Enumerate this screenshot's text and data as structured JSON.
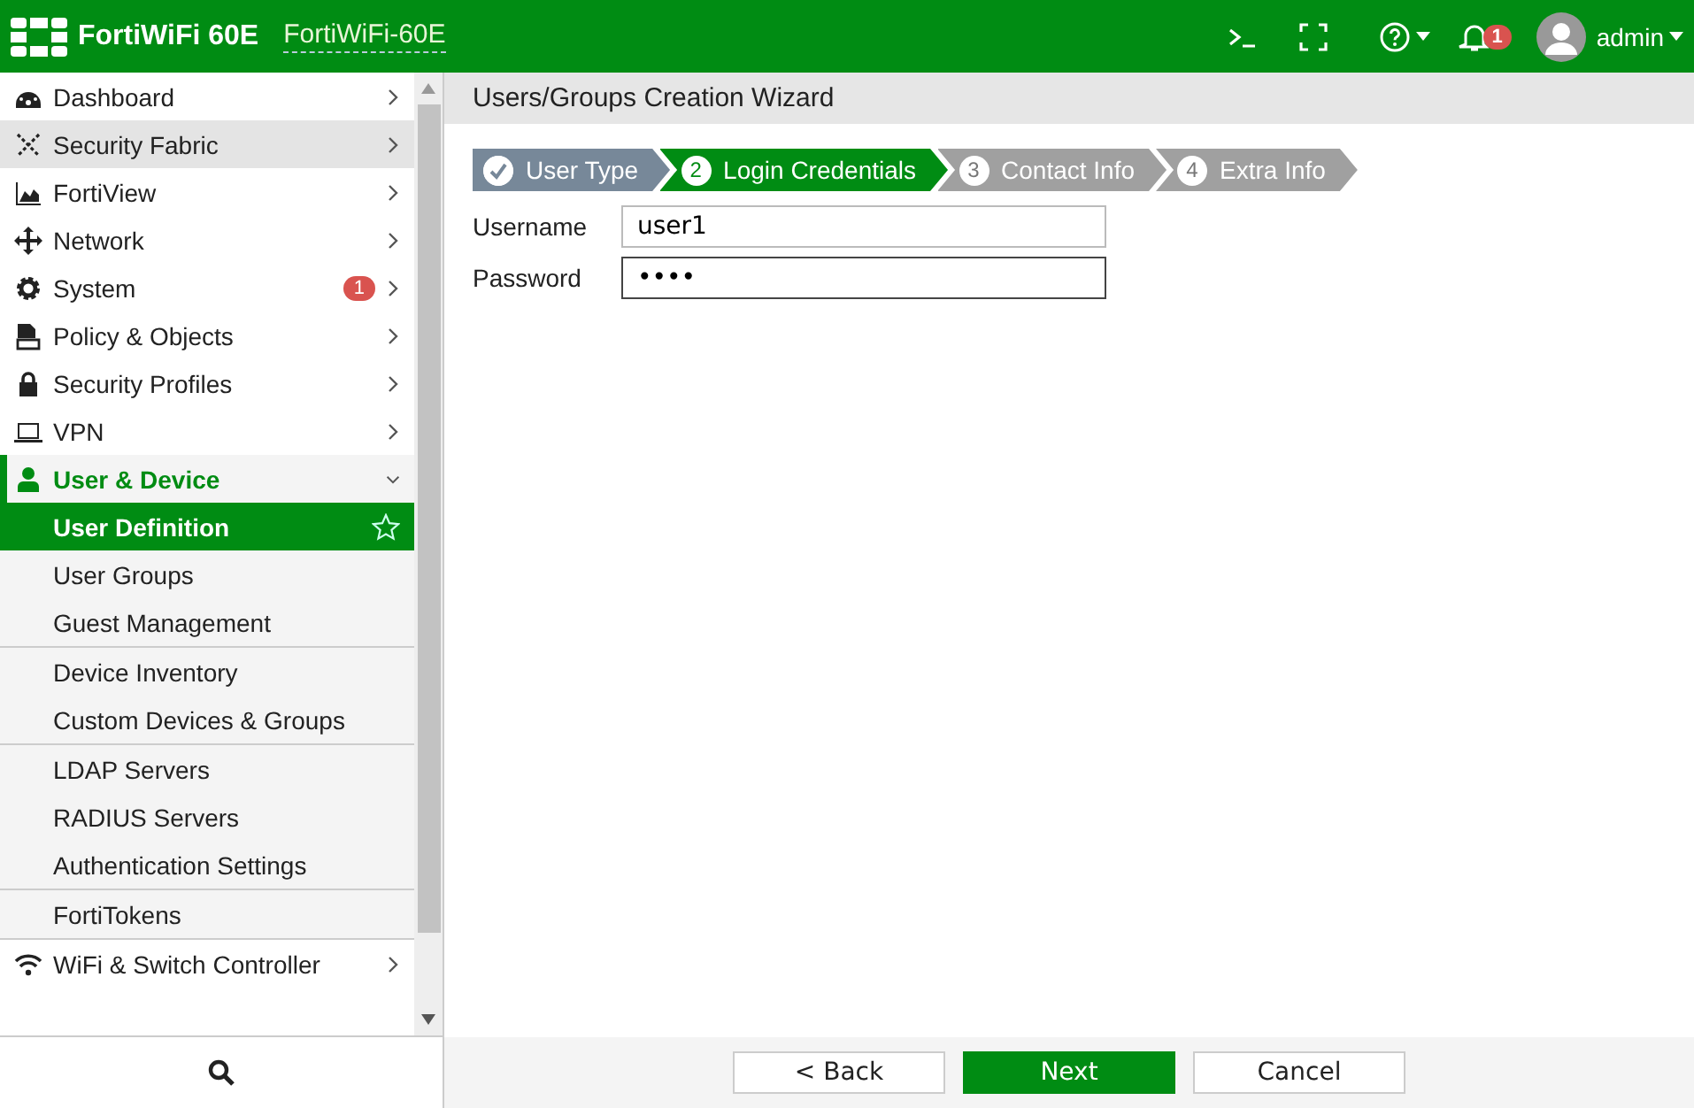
{
  "header": {
    "product": "FortiWiFi 60E",
    "hostname": "FortiWiFi-60E",
    "notification_count": "1",
    "user": "admin"
  },
  "sidebar": {
    "items": [
      {
        "label": "Dashboard",
        "highlighted": false,
        "expanded": false
      },
      {
        "label": "Security Fabric",
        "highlighted": true,
        "expanded": false
      },
      {
        "label": "FortiView",
        "highlighted": false,
        "expanded": false
      },
      {
        "label": "Network",
        "highlighted": false,
        "expanded": false
      },
      {
        "label": "System",
        "highlighted": false,
        "expanded": false,
        "badge": "1"
      },
      {
        "label": "Policy & Objects",
        "highlighted": false,
        "expanded": false
      },
      {
        "label": "Security Profiles",
        "highlighted": false,
        "expanded": false
      },
      {
        "label": "VPN",
        "highlighted": false,
        "expanded": false
      },
      {
        "label": "User & Device",
        "highlighted": false,
        "expanded": true,
        "children": [
          [
            {
              "label": "User Definition",
              "selected": true
            },
            {
              "label": "User Groups",
              "selected": false
            },
            {
              "label": "Guest Management",
              "selected": false
            }
          ],
          [
            {
              "label": "Device Inventory",
              "selected": false
            },
            {
              "label": "Custom Devices & Groups",
              "selected": false
            }
          ],
          [
            {
              "label": "LDAP Servers",
              "selected": false
            },
            {
              "label": "RADIUS Servers",
              "selected": false
            },
            {
              "label": "Authentication Settings",
              "selected": false
            }
          ],
          [
            {
              "label": "FortiTokens",
              "selected": false
            }
          ]
        ]
      },
      {
        "label": "WiFi & Switch Controller",
        "highlighted": false,
        "expanded": false
      }
    ]
  },
  "page": {
    "title": "Users/Groups Creation Wizard",
    "steps": [
      {
        "label": "User Type",
        "completed": true,
        "selected": false
      },
      {
        "number": "2",
        "label": "Login Credentials",
        "completed": false,
        "selected": true
      },
      {
        "number": "3",
        "label": "Contact Info",
        "completed": false,
        "selected": false
      },
      {
        "number": "4",
        "label": "Extra Info",
        "completed": false,
        "selected": false
      }
    ],
    "fields": [
      {
        "label": "Username",
        "value": "user1",
        "focused": false
      },
      {
        "label": "Password",
        "value": "••••",
        "focused": true
      }
    ],
    "buttons": [
      {
        "label": "< Back",
        "kind": "secondary"
      },
      {
        "label": "Next",
        "kind": "primary"
      },
      {
        "label": "Cancel",
        "kind": "secondary"
      }
    ]
  }
}
